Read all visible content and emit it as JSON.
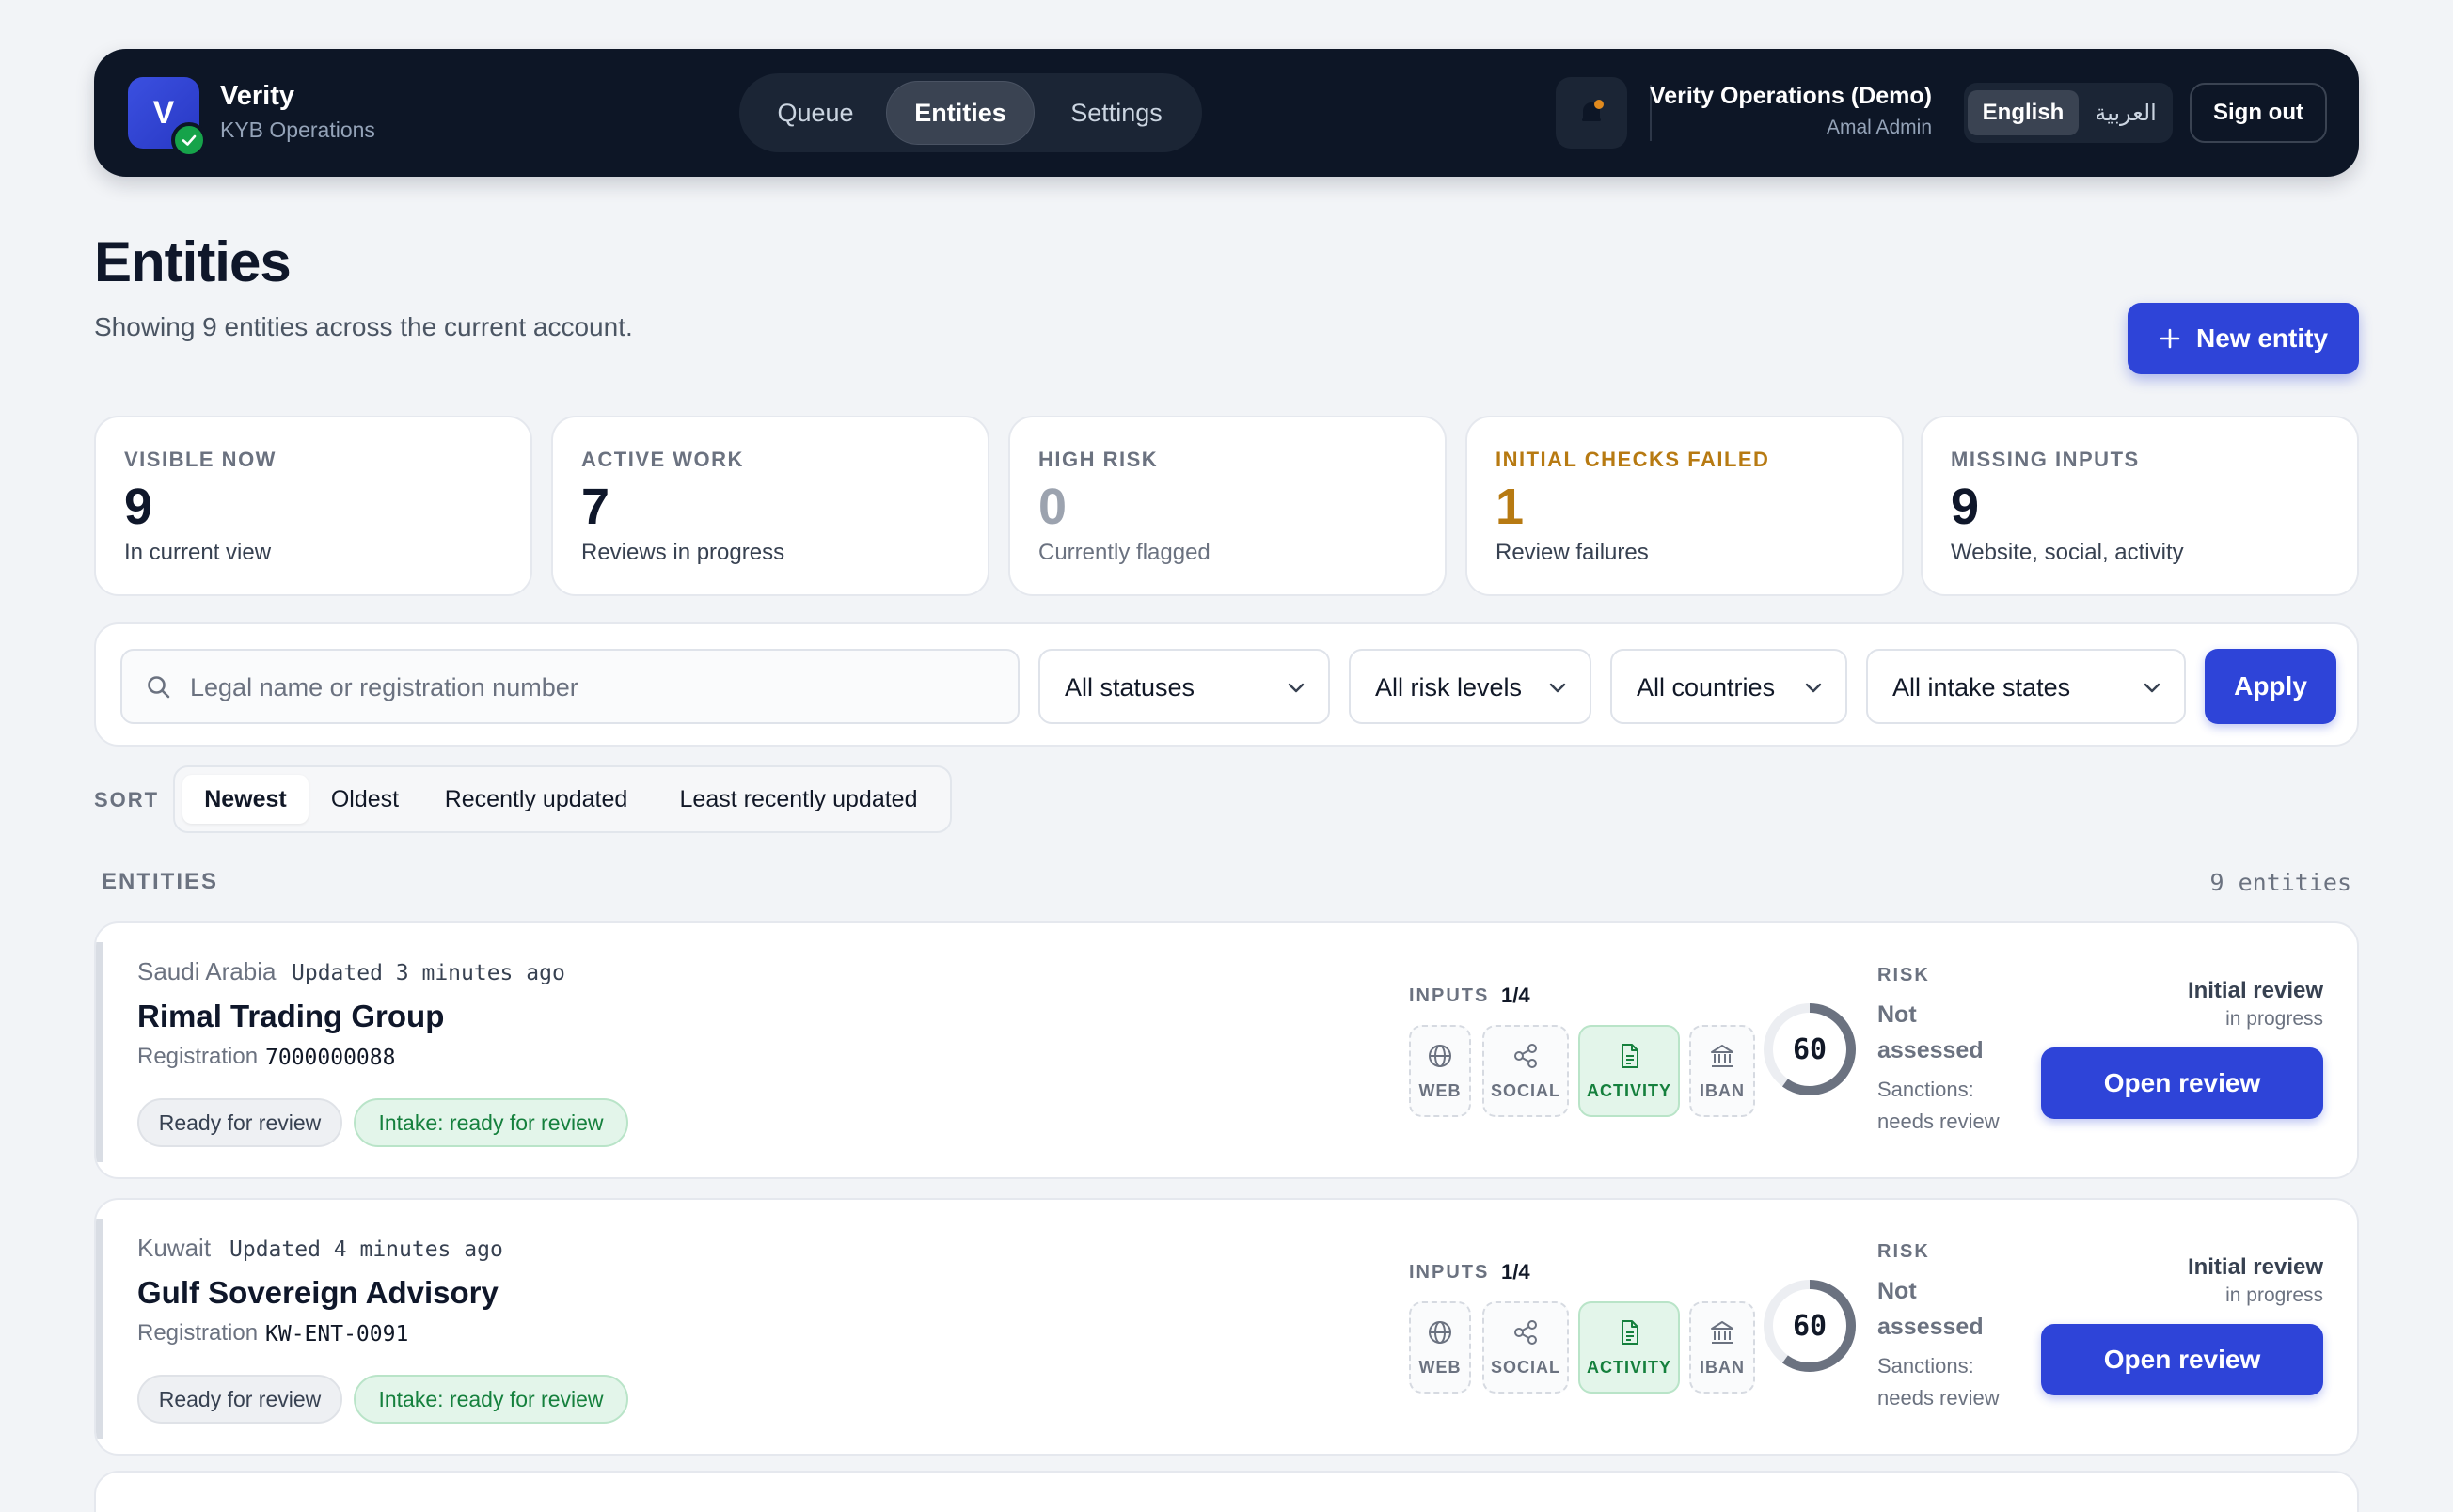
{
  "brand": {
    "initial": "V",
    "name": "Verity",
    "subtitle": "KYB Operations"
  },
  "nav": {
    "tabs": [
      {
        "label": "Queue"
      },
      {
        "label": "Entities"
      },
      {
        "label": "Settings"
      }
    ],
    "active": "Entities"
  },
  "user": {
    "org": "Verity Operations (Demo)",
    "name": "Amal Admin"
  },
  "language": {
    "options": [
      "English",
      "العربية"
    ],
    "active": "English"
  },
  "signout_label": "Sign out",
  "page": {
    "title": "Entities",
    "subtitle": "Showing 9 entities across the current account.",
    "new_button": "New entity"
  },
  "stats": [
    {
      "label": "VISIBLE NOW",
      "value": "9",
      "desc": "In current view"
    },
    {
      "label": "ACTIVE WORK",
      "value": "7",
      "desc": "Reviews in progress"
    },
    {
      "label": "HIGH RISK",
      "value": "0",
      "desc": "Currently flagged"
    },
    {
      "label": "INITIAL CHECKS FAILED",
      "value": "1",
      "desc": "Review failures"
    },
    {
      "label": "MISSING INPUTS",
      "value": "9",
      "desc": "Website, social, activity"
    }
  ],
  "filters": {
    "search_placeholder": "Legal name or registration number",
    "status": "All statuses",
    "risk": "All risk levels",
    "country": "All countries",
    "intake": "All intake states",
    "apply_label": "Apply"
  },
  "sort": {
    "label": "SORT",
    "options": [
      "Newest",
      "Oldest",
      "Recently updated",
      "Least recently updated"
    ],
    "active": "Newest"
  },
  "list": {
    "label": "ENTITIES",
    "count": "9 entities"
  },
  "entities": [
    {
      "country": "Saudi Arabia",
      "updated": "Updated 3 minutes ago",
      "name": "Rimal Trading Group",
      "reg_label": "Registration",
      "reg_value": "7000000088",
      "pills": [
        "Ready for review",
        "Intake: ready for review"
      ],
      "inputs_label": "INPUTS",
      "inputs_count": "1/4",
      "chips": [
        "WEB",
        "SOCIAL",
        "ACTIVITY",
        "IBAN"
      ],
      "score": "60",
      "score_fraction": 0.6,
      "risk_label": "RISK",
      "risk_value": "Not assessed",
      "sanctions": "Sanctions: needs review",
      "status": "Initial review",
      "status_sub": "in progress",
      "action": "Open review"
    },
    {
      "country": "Kuwait",
      "updated": "Updated 4 minutes ago",
      "name": "Gulf Sovereign Advisory",
      "reg_label": "Registration",
      "reg_value": "KW-ENT-0091",
      "pills": [
        "Ready for review",
        "Intake: ready for review"
      ],
      "inputs_label": "INPUTS",
      "inputs_count": "1/4",
      "chips": [
        "WEB",
        "SOCIAL",
        "ACTIVITY",
        "IBAN"
      ],
      "score": "60",
      "score_fraction": 0.6,
      "risk_label": "RISK",
      "risk_value": "Not assessed",
      "sanctions": "Sanctions: needs review",
      "status": "Initial review",
      "status_sub": "in progress",
      "action": "Open review"
    }
  ],
  "colors": {
    "accent": "#2e44d8",
    "nav_bg": "#0d1626",
    "success": "#16a34a",
    "warning": "#b77a12"
  }
}
